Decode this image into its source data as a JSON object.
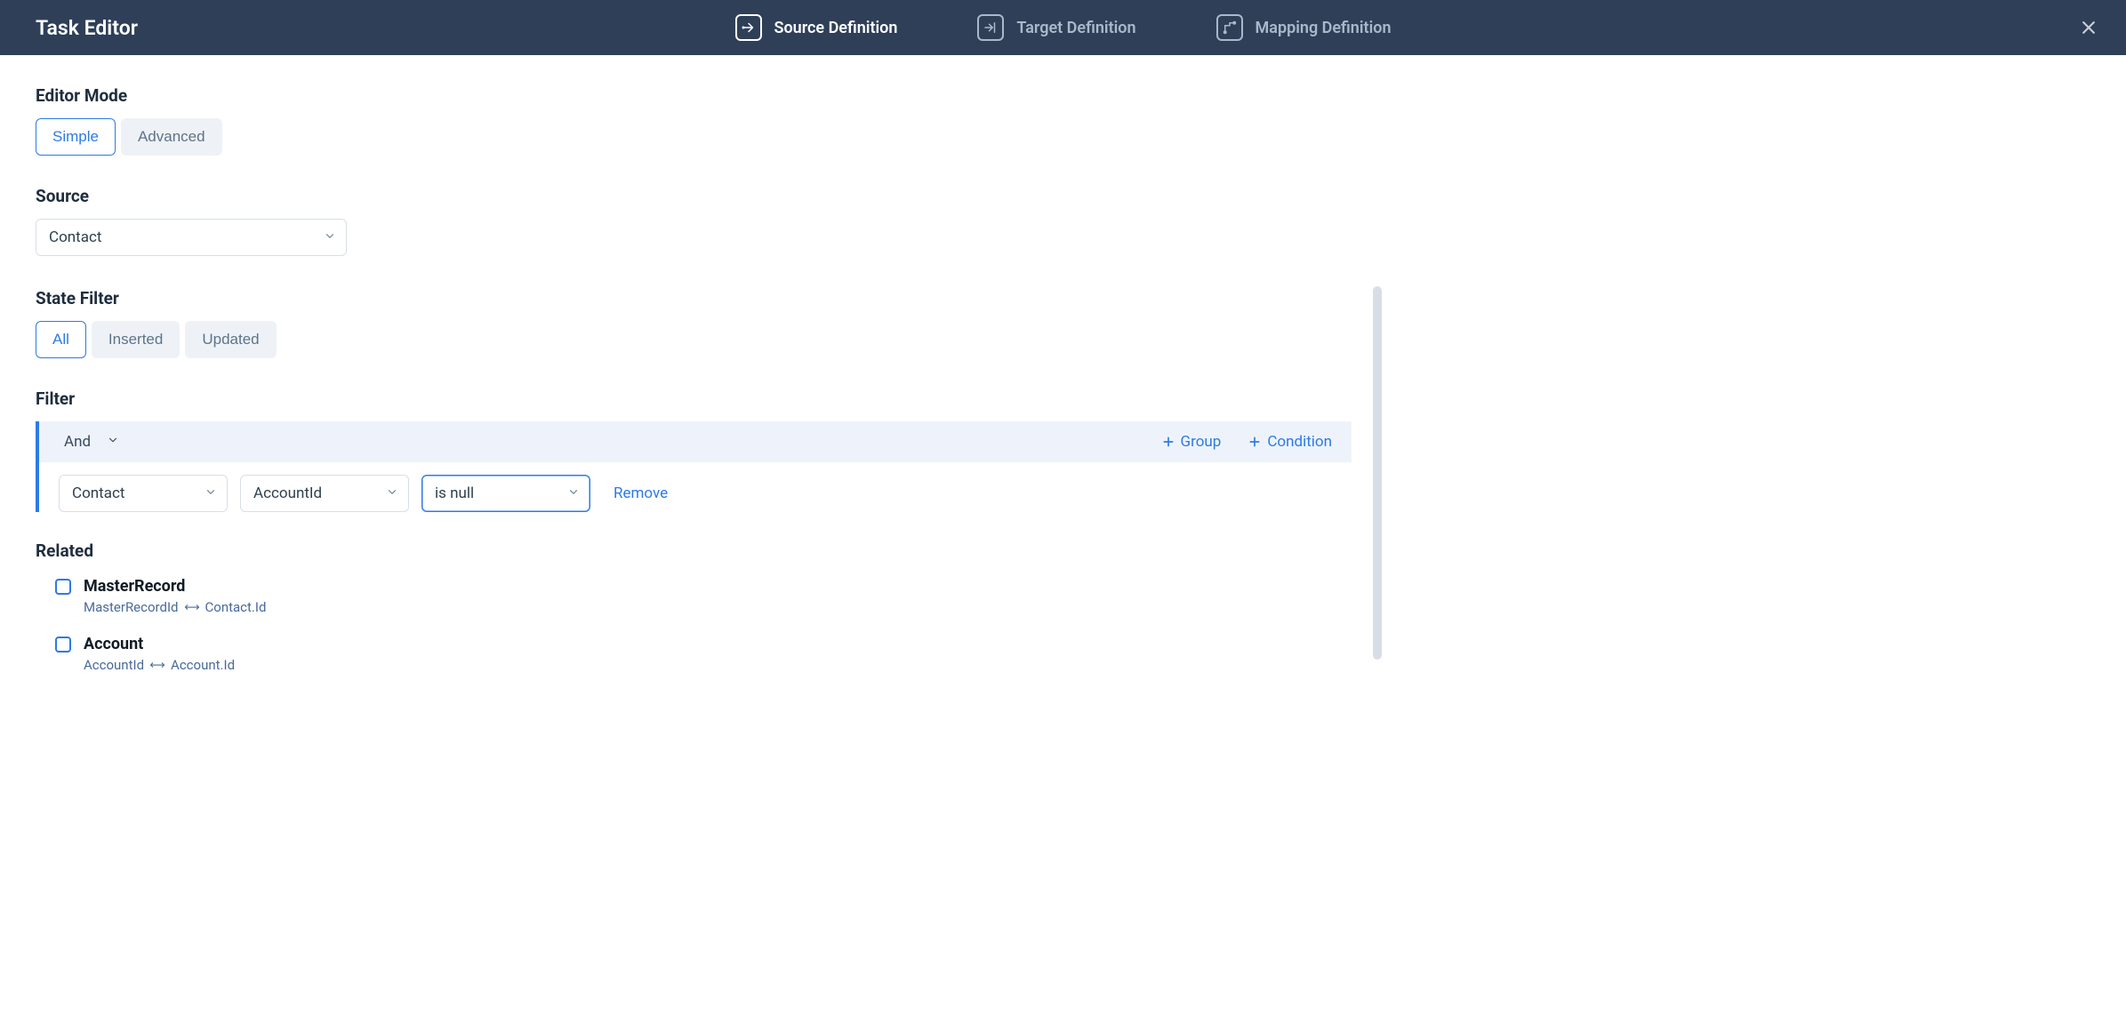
{
  "header": {
    "title": "Task Editor",
    "tabs": [
      {
        "label": "Source Definition",
        "active": true
      },
      {
        "label": "Target Definition",
        "active": false
      },
      {
        "label": "Mapping Definition",
        "active": false
      }
    ]
  },
  "editor_mode": {
    "label": "Editor Mode",
    "options": [
      "Simple",
      "Advanced"
    ],
    "selected": "Simple"
  },
  "source": {
    "label": "Source",
    "value": "Contact"
  },
  "state_filter": {
    "label": "State Filter",
    "options": [
      "All",
      "Inserted",
      "Updated"
    ],
    "selected": "All"
  },
  "filter": {
    "label": "Filter",
    "group_operator": "And",
    "actions": {
      "group": "Group",
      "condition": "Condition"
    },
    "conditions": [
      {
        "entity": "Contact",
        "field": "AccountId",
        "operator": "is null",
        "remove_label": "Remove"
      }
    ]
  },
  "related": {
    "label": "Related",
    "items": [
      {
        "title": "MasterRecord",
        "left": "MasterRecordId",
        "right": "Contact.Id",
        "checked": false
      },
      {
        "title": "Account",
        "left": "AccountId",
        "right": "Account.Id",
        "checked": false
      }
    ]
  },
  "colors": {
    "accent": "#2c7be5",
    "header_bg": "#2f3f58"
  }
}
